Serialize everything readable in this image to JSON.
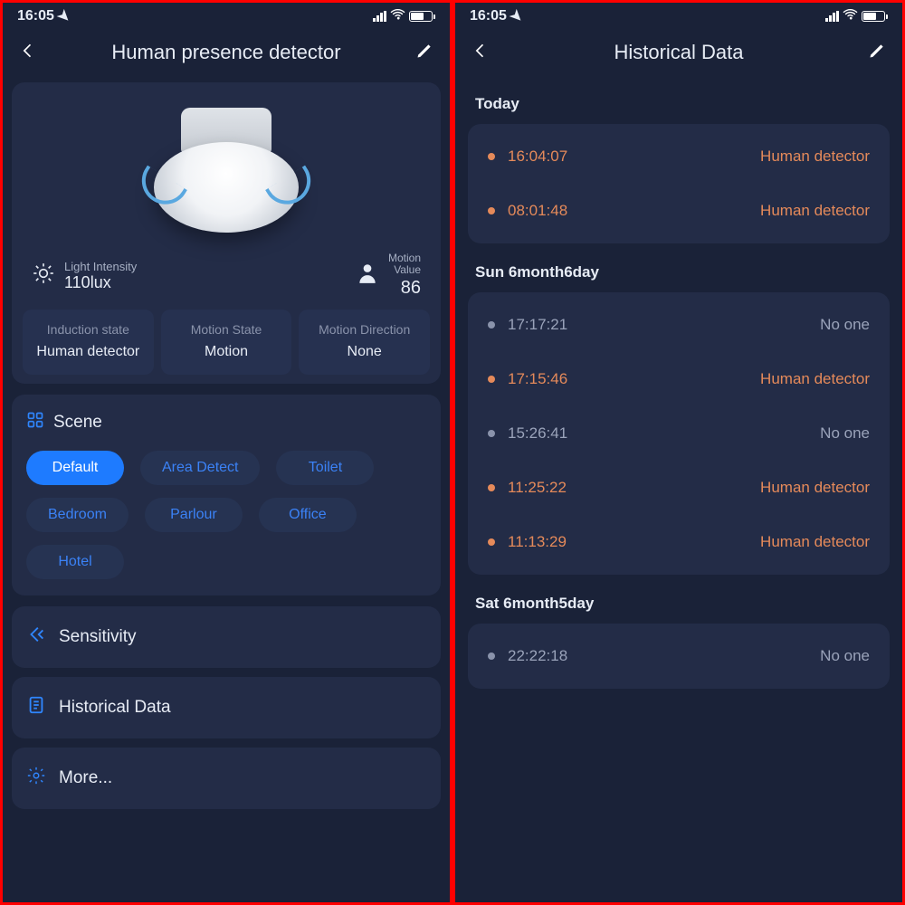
{
  "status_time": "16:05",
  "screen1": {
    "title": "Human presence detector",
    "light_label": "Light Intensity",
    "light_value": "110lux",
    "motion_label1": "Motion",
    "motion_label2": "Value",
    "motion_value": "86",
    "tiles": [
      {
        "label": "Induction state",
        "value": "Human detector"
      },
      {
        "label": "Motion State",
        "value": "Motion"
      },
      {
        "label": "Motion Direction",
        "value": "None"
      }
    ],
    "scene_title": "Scene",
    "scenes": [
      "Default",
      "Area Detect",
      "Toilet",
      "Bedroom",
      "Parlour",
      "Office",
      "Hotel"
    ],
    "scene_active_index": 0,
    "row_sensitivity": "Sensitivity",
    "row_history": "Historical Data",
    "row_more": "More..."
  },
  "screen2": {
    "title": "Historical Data",
    "sections": [
      {
        "label": "Today",
        "rows": [
          {
            "time": "16:04:07",
            "status": "Human detector",
            "tone": "orange"
          },
          {
            "time": "08:01:48",
            "status": "Human detector",
            "tone": "orange"
          }
        ]
      },
      {
        "label": "Sun  6month6day",
        "rows": [
          {
            "time": "17:17:21",
            "status": "No one",
            "tone": "grey"
          },
          {
            "time": "17:15:46",
            "status": "Human detector",
            "tone": "orange"
          },
          {
            "time": "15:26:41",
            "status": "No one",
            "tone": "grey"
          },
          {
            "time": "11:25:22",
            "status": "Human detector",
            "tone": "orange"
          },
          {
            "time": "11:13:29",
            "status": "Human detector",
            "tone": "orange"
          }
        ]
      },
      {
        "label": "Sat  6month5day",
        "rows": [
          {
            "time": "22:22:18",
            "status": "No one",
            "tone": "grey"
          }
        ]
      }
    ]
  }
}
